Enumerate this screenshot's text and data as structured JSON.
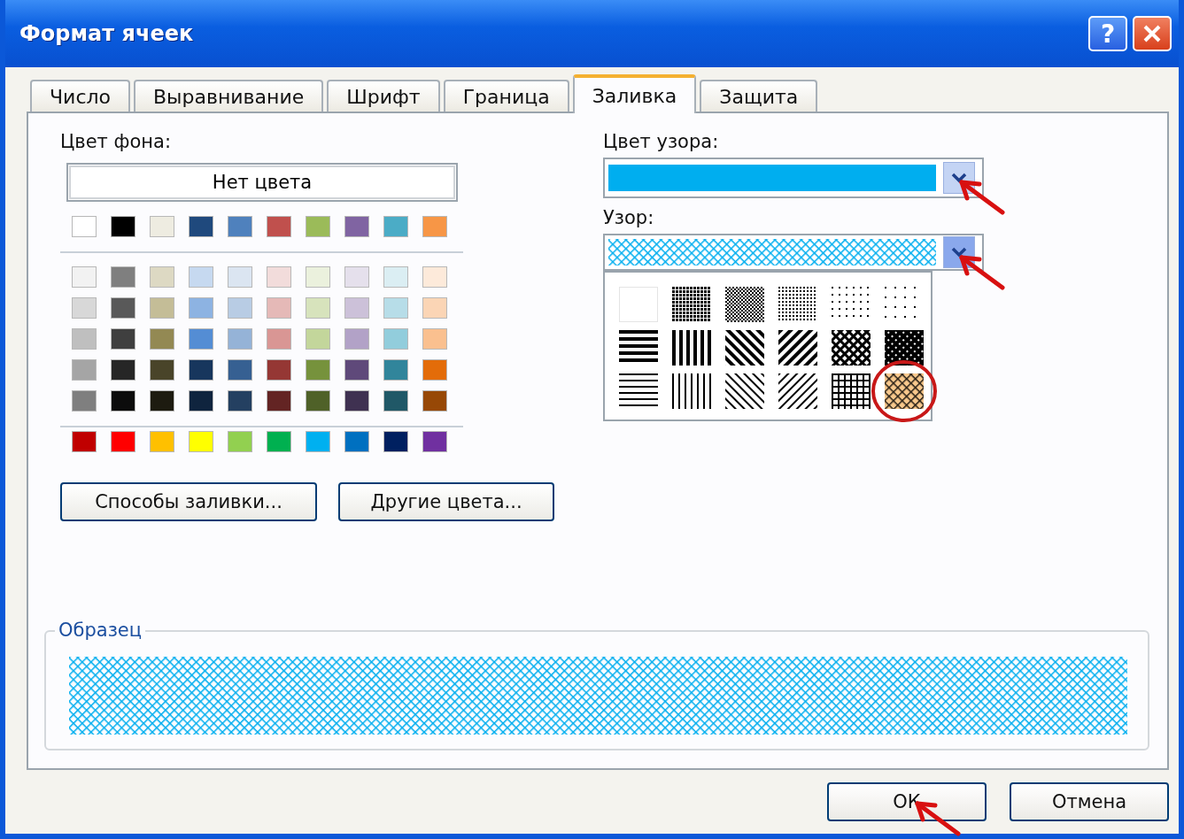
{
  "window": {
    "title": "Формат ячеек",
    "help": "?"
  },
  "tabs": [
    {
      "label": "Число",
      "selected": false
    },
    {
      "label": "Выравнивание",
      "selected": false
    },
    {
      "label": "Шрифт",
      "selected": false
    },
    {
      "label": "Граница",
      "selected": false
    },
    {
      "label": "Заливка",
      "selected": true
    },
    {
      "label": "Защита",
      "selected": false
    }
  ],
  "background": {
    "label": "Цвет фона:",
    "no_color_button": "Нет цвета",
    "theme_colors": [
      {
        "color": "#ffffff"
      },
      {
        "color": "#000000"
      },
      {
        "color": "#eeece1"
      },
      {
        "color": "#1f497d"
      },
      {
        "color": "#4f81bd"
      },
      {
        "color": "#c0504d"
      },
      {
        "color": "#9bbb59"
      },
      {
        "color": "#8064a2"
      },
      {
        "color": "#4bacc6"
      },
      {
        "color": "#f79646"
      }
    ],
    "tint_rows": [
      [
        {
          "color": "#f2f2f2"
        },
        {
          "color": "#7f7f7f"
        },
        {
          "color": "#ddd9c3"
        },
        {
          "color": "#c6d9f0"
        },
        {
          "color": "#dbe5f1"
        },
        {
          "color": "#f2dcdb"
        },
        {
          "color": "#ebf1dd"
        },
        {
          "color": "#e5e0ec"
        },
        {
          "color": "#dbeef3"
        },
        {
          "color": "#fdeada"
        }
      ],
      [
        {
          "color": "#d8d8d8"
        },
        {
          "color": "#595959"
        },
        {
          "color": "#c4bd97"
        },
        {
          "color": "#8db3e2"
        },
        {
          "color": "#b8cce4"
        },
        {
          "color": "#e5b9b7"
        },
        {
          "color": "#d7e3bc"
        },
        {
          "color": "#ccc1d9"
        },
        {
          "color": "#b7dde8"
        },
        {
          "color": "#fbd5b5"
        }
      ],
      [
        {
          "color": "#bfbfbf"
        },
        {
          "color": "#3f3f3f"
        },
        {
          "color": "#938953"
        },
        {
          "color": "#548dd4"
        },
        {
          "color": "#95b3d7"
        },
        {
          "color": "#d99694"
        },
        {
          "color": "#c3d69b"
        },
        {
          "color": "#b2a2c7"
        },
        {
          "color": "#92cddc"
        },
        {
          "color": "#fac08f"
        }
      ],
      [
        {
          "color": "#a5a5a5"
        },
        {
          "color": "#262626"
        },
        {
          "color": "#494429"
        },
        {
          "color": "#17365d"
        },
        {
          "color": "#366092"
        },
        {
          "color": "#953734"
        },
        {
          "color": "#76923c"
        },
        {
          "color": "#5f497a"
        },
        {
          "color": "#31859b"
        },
        {
          "color": "#e36c09"
        }
      ],
      [
        {
          "color": "#7f7f7f"
        },
        {
          "color": "#0c0c0c"
        },
        {
          "color": "#1d1b10"
        },
        {
          "color": "#0f243e"
        },
        {
          "color": "#244061"
        },
        {
          "color": "#632423"
        },
        {
          "color": "#4f6128"
        },
        {
          "color": "#3f3151"
        },
        {
          "color": "#205867"
        },
        {
          "color": "#974806"
        }
      ]
    ],
    "standard_colors": [
      {
        "color": "#c00000"
      },
      {
        "color": "#ff0000"
      },
      {
        "color": "#ffc000"
      },
      {
        "color": "#ffff00"
      },
      {
        "color": "#92d050"
      },
      {
        "color": "#00b050"
      },
      {
        "color": "#00b0f0"
      },
      {
        "color": "#0070c0"
      },
      {
        "color": "#002060"
      },
      {
        "color": "#7030a0"
      }
    ],
    "buttons": [
      "Способы заливки...",
      "Другие цвета..."
    ]
  },
  "pattern_color": {
    "label": "Цвет узора:",
    "color": "#00aeef"
  },
  "pattern": {
    "label": "Узор:",
    "expanded": true,
    "options": [
      {
        "kind": "none",
        "selected": false
      },
      {
        "kind": "dark-gray",
        "selected": false
      },
      {
        "kind": "medium-gray",
        "selected": false
      },
      {
        "kind": "light-gray",
        "selected": false
      },
      {
        "kind": "sparse-dots",
        "selected": false
      },
      {
        "kind": "very-sparse-dots",
        "selected": false
      },
      {
        "kind": "thick-horizontal",
        "selected": false
      },
      {
        "kind": "thick-vertical",
        "selected": false
      },
      {
        "kind": "thick-diagonal-down",
        "selected": false
      },
      {
        "kind": "thick-diagonal-up",
        "selected": false
      },
      {
        "kind": "diagonal-crosshatch",
        "selected": false
      },
      {
        "kind": "thick-diagonal-crosshatch",
        "selected": false
      },
      {
        "kind": "thin-horizontal",
        "selected": false
      },
      {
        "kind": "thin-vertical",
        "selected": false
      },
      {
        "kind": "thin-diagonal-down",
        "selected": false
      },
      {
        "kind": "thin-diagonal-up",
        "selected": false
      },
      {
        "kind": "thin-grid",
        "selected": false
      },
      {
        "kind": "thin-diagonal-crosshatch",
        "selected": true
      }
    ]
  },
  "sample": {
    "label": "Образец"
  },
  "dialog_buttons": [
    "ОК",
    "Отмена"
  ]
}
